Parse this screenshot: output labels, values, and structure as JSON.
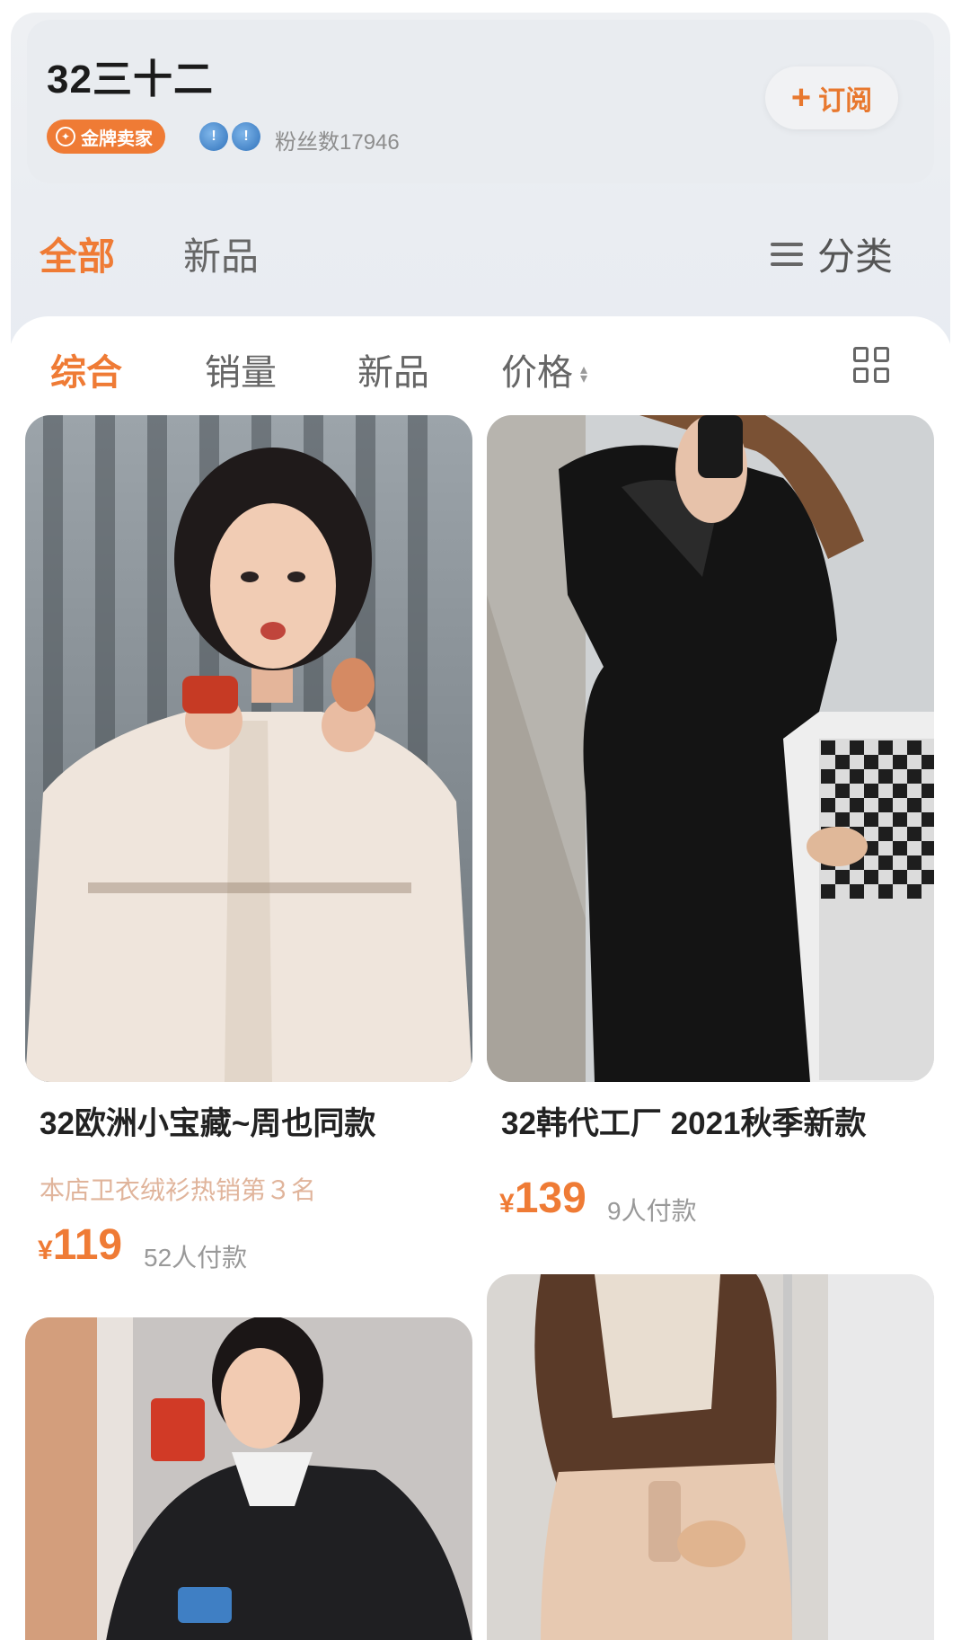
{
  "store": {
    "name": "32三十二",
    "badge": "金牌卖家",
    "fans": "粉丝数17946",
    "subscribe_label": "订阅"
  },
  "tabs": [
    {
      "label": "全部",
      "active": true
    },
    {
      "label": "新品",
      "active": false
    }
  ],
  "category_label": "分类",
  "sort_tabs": [
    {
      "label": "综合",
      "active": true
    },
    {
      "label": "销量",
      "active": false
    },
    {
      "label": "新品",
      "active": false
    },
    {
      "label": "价格",
      "active": false
    }
  ],
  "products": [
    {
      "title": "32欧洲小宝藏~周也同款",
      "rank": "本店卫衣绒衫热销第３名",
      "currency": "¥",
      "price": "119",
      "paid": "52人付款"
    },
    {
      "title": "32韩代工厂 2021秋季新款",
      "currency": "¥",
      "price": "139",
      "paid": "9人付款"
    },
    {
      "title": ""
    },
    {
      "title": ""
    }
  ],
  "colors": {
    "accent": "#ef7b35",
    "level_icon": "#3f7fc4"
  },
  "icons": [
    "plus-icon",
    "list-icon",
    "sort-arrows-icon",
    "grid-view-icon",
    "level-icon"
  ]
}
